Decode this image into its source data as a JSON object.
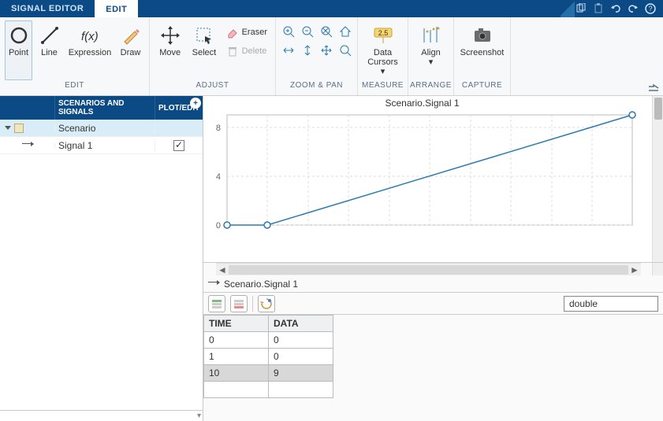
{
  "tabs": {
    "signal_editor": "SIGNAL EDITOR",
    "edit": "EDIT"
  },
  "ribbon": {
    "edit": {
      "point": "Point",
      "line": "Line",
      "expression": "Expression",
      "draw": "Draw",
      "label": "EDIT"
    },
    "adjust": {
      "move": "Move",
      "select": "Select",
      "eraser": "Eraser",
      "delete": "Delete",
      "label": "ADJUST"
    },
    "zoom": {
      "label": "ZOOM & PAN"
    },
    "measure": {
      "data_cursors": "Data",
      "data_cursors2": "Cursors",
      "label": "MEASURE",
      "badge": "2.5"
    },
    "arrange": {
      "align": "Align",
      "label": "ARRANGE"
    },
    "capture": {
      "screenshot": "Screenshot",
      "label": "CAPTURE"
    }
  },
  "tree": {
    "header": {
      "scenarios": "SCENARIOS AND SIGNALS",
      "plot": "PLOT/EDIT"
    },
    "scenario": {
      "label": "Scenario"
    },
    "signal": {
      "label": "Signal 1",
      "checked": true
    }
  },
  "plot": {
    "title": "Scenario.Signal 1",
    "y_ticks": [
      "0",
      "4",
      "8"
    ]
  },
  "signal_panel": {
    "name": "Scenario.Signal 1",
    "dtype": "double",
    "headers": {
      "time": "TIME",
      "data": "DATA"
    },
    "rows": [
      {
        "t": "0",
        "d": "0"
      },
      {
        "t": "1",
        "d": "0"
      },
      {
        "t": "10",
        "d": "9"
      }
    ]
  },
  "chart_data": {
    "type": "line",
    "title": "Scenario.Signal 1",
    "xlabel": "",
    "ylabel": "",
    "xlim": [
      0,
      10
    ],
    "ylim": [
      0,
      9
    ],
    "y_ticks": [
      0,
      4,
      8
    ],
    "series": [
      {
        "name": "Signal 1",
        "x": [
          0,
          1,
          10
        ],
        "y": [
          0,
          0,
          9
        ]
      }
    ]
  }
}
